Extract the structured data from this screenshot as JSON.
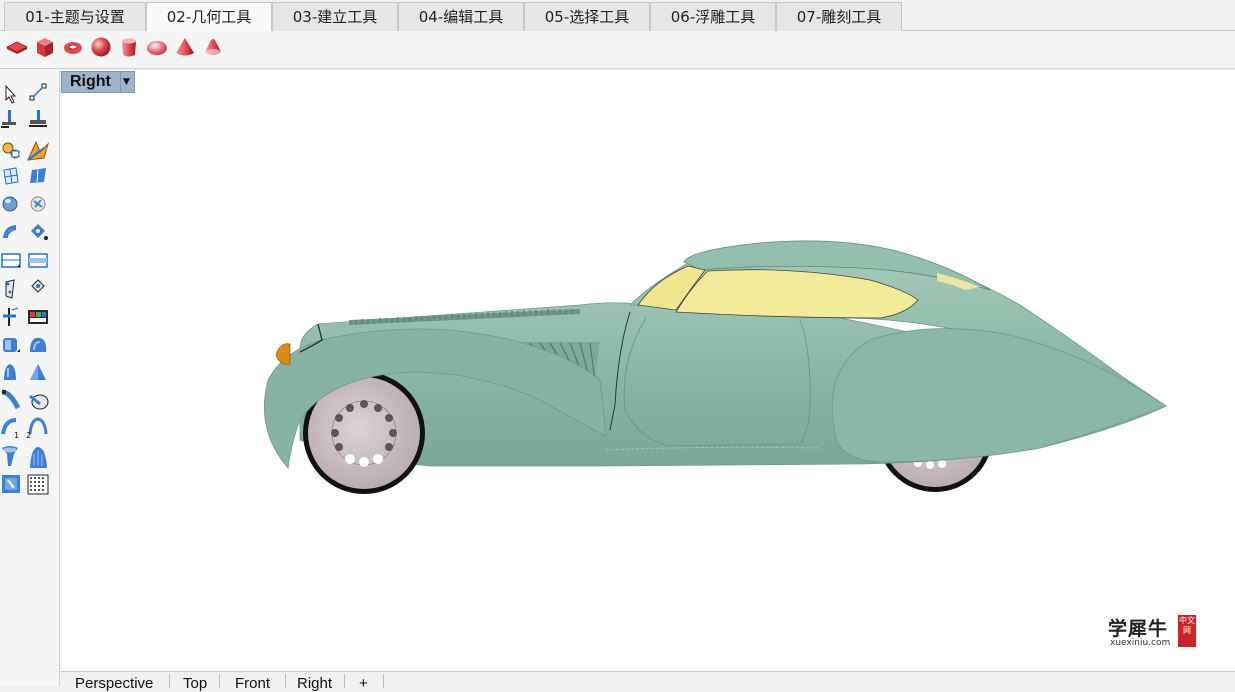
{
  "tabs": [
    {
      "label": "01-主题与设置",
      "active": false
    },
    {
      "label": "02-几何工具",
      "active": true
    },
    {
      "label": "03-建立工具",
      "active": false
    },
    {
      "label": "04-编辑工具",
      "active": false
    },
    {
      "label": "05-选择工具",
      "active": false
    },
    {
      "label": "06-浮雕工具",
      "active": false
    },
    {
      "label": "07-雕刻工具",
      "active": false
    }
  ],
  "toolbar": {
    "icons": [
      "plane-primitive-icon",
      "box-primitive-icon",
      "torus-primitive-icon",
      "sphere-primitive-icon",
      "cylinder-primitive-icon",
      "ellipsoid-primitive-icon",
      "cone-primitive-icon",
      "paraboloid-primitive-icon"
    ],
    "primitive_color": "#d9363e"
  },
  "viewport": {
    "name": "Right",
    "background": "#ffffff",
    "model": {
      "body_color": "#88b5a4",
      "glass_color": "#f2ec9a",
      "wheel_color": "#cbbfc2",
      "tire_color": "#111111",
      "lamp_color": "#e08a12"
    }
  },
  "watermark": {
    "main": "学犀牛",
    "sub": "xuexiniu.com",
    "badge": "中文网"
  },
  "bottom_tabs": [
    "Perspective",
    "Top",
    "Front",
    "Right",
    "+"
  ]
}
